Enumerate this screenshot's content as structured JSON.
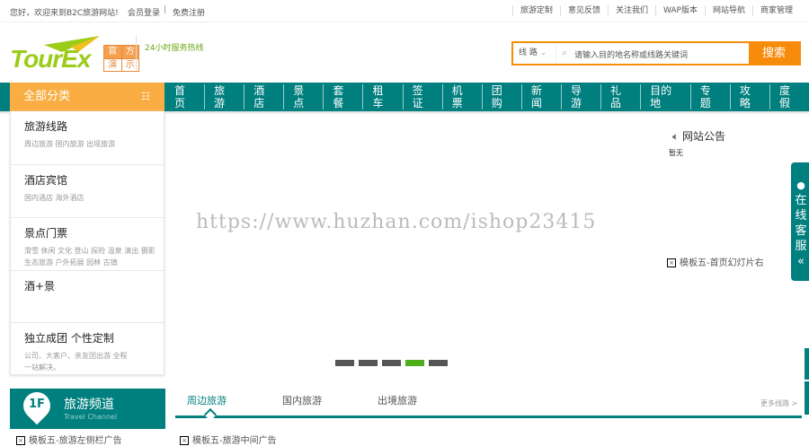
{
  "topbar": {
    "welcome": "您好，欢迎来到B2C旅游网站!",
    "login": "会员登录",
    "sep": "|",
    "register": "免费注册",
    "links": [
      "旅游定制",
      "意见反馈",
      "关注我们",
      "WAP版本",
      "网站导航",
      "商家管理"
    ]
  },
  "logo": {
    "text": "TourEx",
    "badge": [
      "官",
      "方",
      "演",
      "示"
    ]
  },
  "hotline": "24小时服务热线",
  "search": {
    "type": "线 路",
    "placeholder": "请输入目的地名称或线路关键词",
    "button": "搜索"
  },
  "category": {
    "label": "全部分类"
  },
  "nav": [
    "首页",
    "旅游",
    "酒店",
    "景点",
    "套餐",
    "租车",
    "签证",
    "机票",
    "团购",
    "新闻",
    "导游",
    "礼品",
    "目的地",
    "专题",
    "攻略",
    "度假"
  ],
  "menu": [
    {
      "title": "旅游线路",
      "subs": "周边旅游 国内旅游 出境旅游"
    },
    {
      "title": "酒店宾馆",
      "subs": "国内酒店 海外酒店"
    },
    {
      "title": "景点门票",
      "subs": "滑雪 休闲 文化 登山 探险 温泉 演出 摄影 生态旅游 户外拓展 园林 古镇"
    },
    {
      "title": "酒+景",
      "subs": ""
    },
    {
      "title": "独立成团 个性定制",
      "subs": "公司、大客户、亲友团出游 全程一站解决。"
    }
  ],
  "watermark": "https://www.huzhan.com/ishop23415",
  "notice": {
    "title": "网站公告",
    "body": "暂无"
  },
  "slider_ad": "模板五-首页幻灯片右",
  "slider": {
    "count": 5,
    "active": 4
  },
  "service": {
    "chars": [
      "在",
      "线",
      "客",
      "服"
    ],
    "arrow": "«"
  },
  "floor": {
    "num": "1F",
    "title": "旅游频道",
    "subtitle": "Travel Channel",
    "left_ad": "模板五-旅游左侧栏广告",
    "tabs": [
      "周边旅游",
      "国内旅游",
      "出境旅游"
    ],
    "more": "更多线路 >",
    "mid_ad": "模板五-旅游中间广告"
  }
}
